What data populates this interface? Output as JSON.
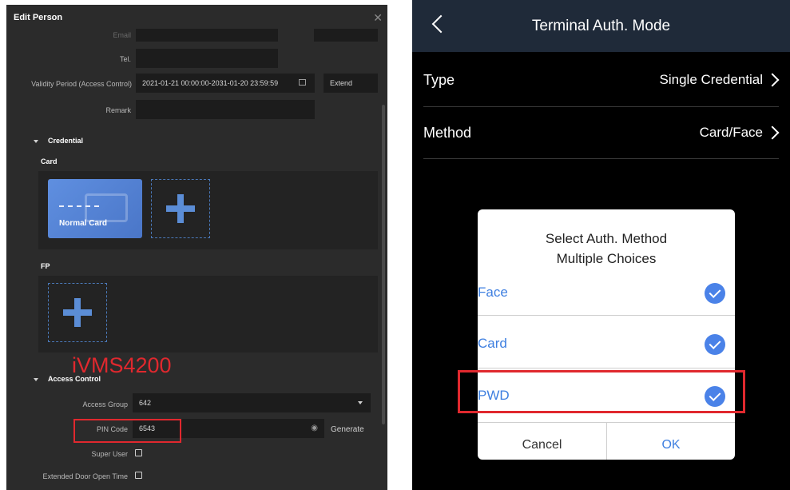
{
  "left": {
    "title": "Edit Person",
    "close_icon": "close-icon",
    "fields": {
      "email_label": "Email",
      "tel_label": "Tel.",
      "tel_value": "",
      "validity_label": "Validity Period (Access Control)",
      "validity_value": "2021-01-21 00:00:00-2031-01-20 23:59:59",
      "extend_label": "Extend",
      "remark_label": "Remark",
      "remark_value": ""
    },
    "credential_section": "Credential",
    "card_heading": "Card",
    "card_label": "Normal Card",
    "fp_heading": "FP",
    "watermark": "iVMS4200",
    "access_section": "Access Control",
    "access_group_label": "Access Group",
    "access_group_value": "642",
    "pin_label": "PIN Code",
    "pin_value": "6543",
    "generate_label": "Generate",
    "super_user_label": "Super User",
    "extended_door_label": "Extended Door Open Time"
  },
  "right": {
    "title": "Terminal Auth. Mode",
    "type_label": "Type",
    "type_value": "Single Credential",
    "method_label": "Method",
    "method_value": "Card/Face",
    "dialog": {
      "title_line1": "Select Auth. Method",
      "title_line2": "Multiple Choices",
      "options": [
        "Face",
        "Card",
        "PWD"
      ],
      "cancel": "Cancel",
      "ok": "OK"
    }
  },
  "colors": {
    "highlight_red": "#e0282e",
    "accent_blue": "#4a82e8",
    "panel_dark": "#2b2b2b"
  }
}
